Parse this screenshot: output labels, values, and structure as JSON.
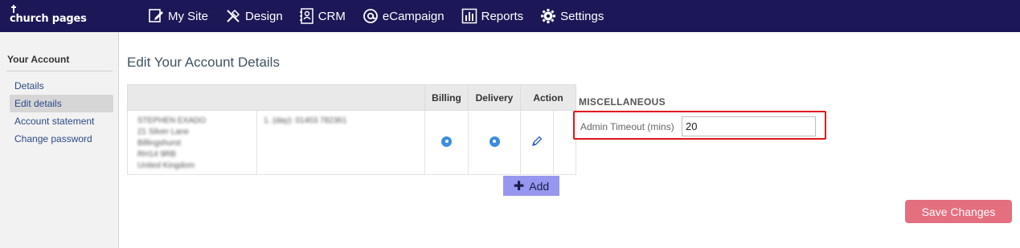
{
  "brand": {
    "name": "church pages"
  },
  "nav": {
    "items": [
      {
        "label": "My Site",
        "icon": "edit-page-icon"
      },
      {
        "label": "Design",
        "icon": "design-tools-icon"
      },
      {
        "label": "CRM",
        "icon": "contact-card-icon"
      },
      {
        "label": "eCampaign",
        "icon": "at-sign-icon"
      },
      {
        "label": "Reports",
        "icon": "bar-chart-icon"
      },
      {
        "label": "Settings",
        "icon": "gear-icon"
      }
    ]
  },
  "sidebar": {
    "title": "Your Account",
    "items": [
      {
        "label": "Details",
        "active": false
      },
      {
        "label": "Edit details",
        "active": true
      },
      {
        "label": "Account statement",
        "active": false
      },
      {
        "label": "Change password",
        "active": false
      }
    ]
  },
  "main": {
    "title": "Edit Your Account Details",
    "table": {
      "headers": {
        "billing": "Billing",
        "delivery": "Delivery",
        "action": "Action"
      },
      "rows": [
        {
          "address_lines": [
            "STEPHEN EXADO",
            "21 Silver Lane",
            "Billingshurst",
            "RH14 9RB",
            "United Kingdom"
          ],
          "phone": "1. (day): 01403 782361",
          "billing_selected": true,
          "delivery_selected": true
        }
      ]
    },
    "add_label": "Add"
  },
  "misc": {
    "title": "MISCELLANEOUS",
    "timeout_label": "Admin Timeout (mins)",
    "timeout_value": "20"
  },
  "save_label": "Save Changes",
  "colors": {
    "topbar": "#1c1756",
    "add_button": "#9797ef",
    "save_button": "#e46f7e",
    "highlight": "#e0141b",
    "radio": "#3b8ddb"
  }
}
